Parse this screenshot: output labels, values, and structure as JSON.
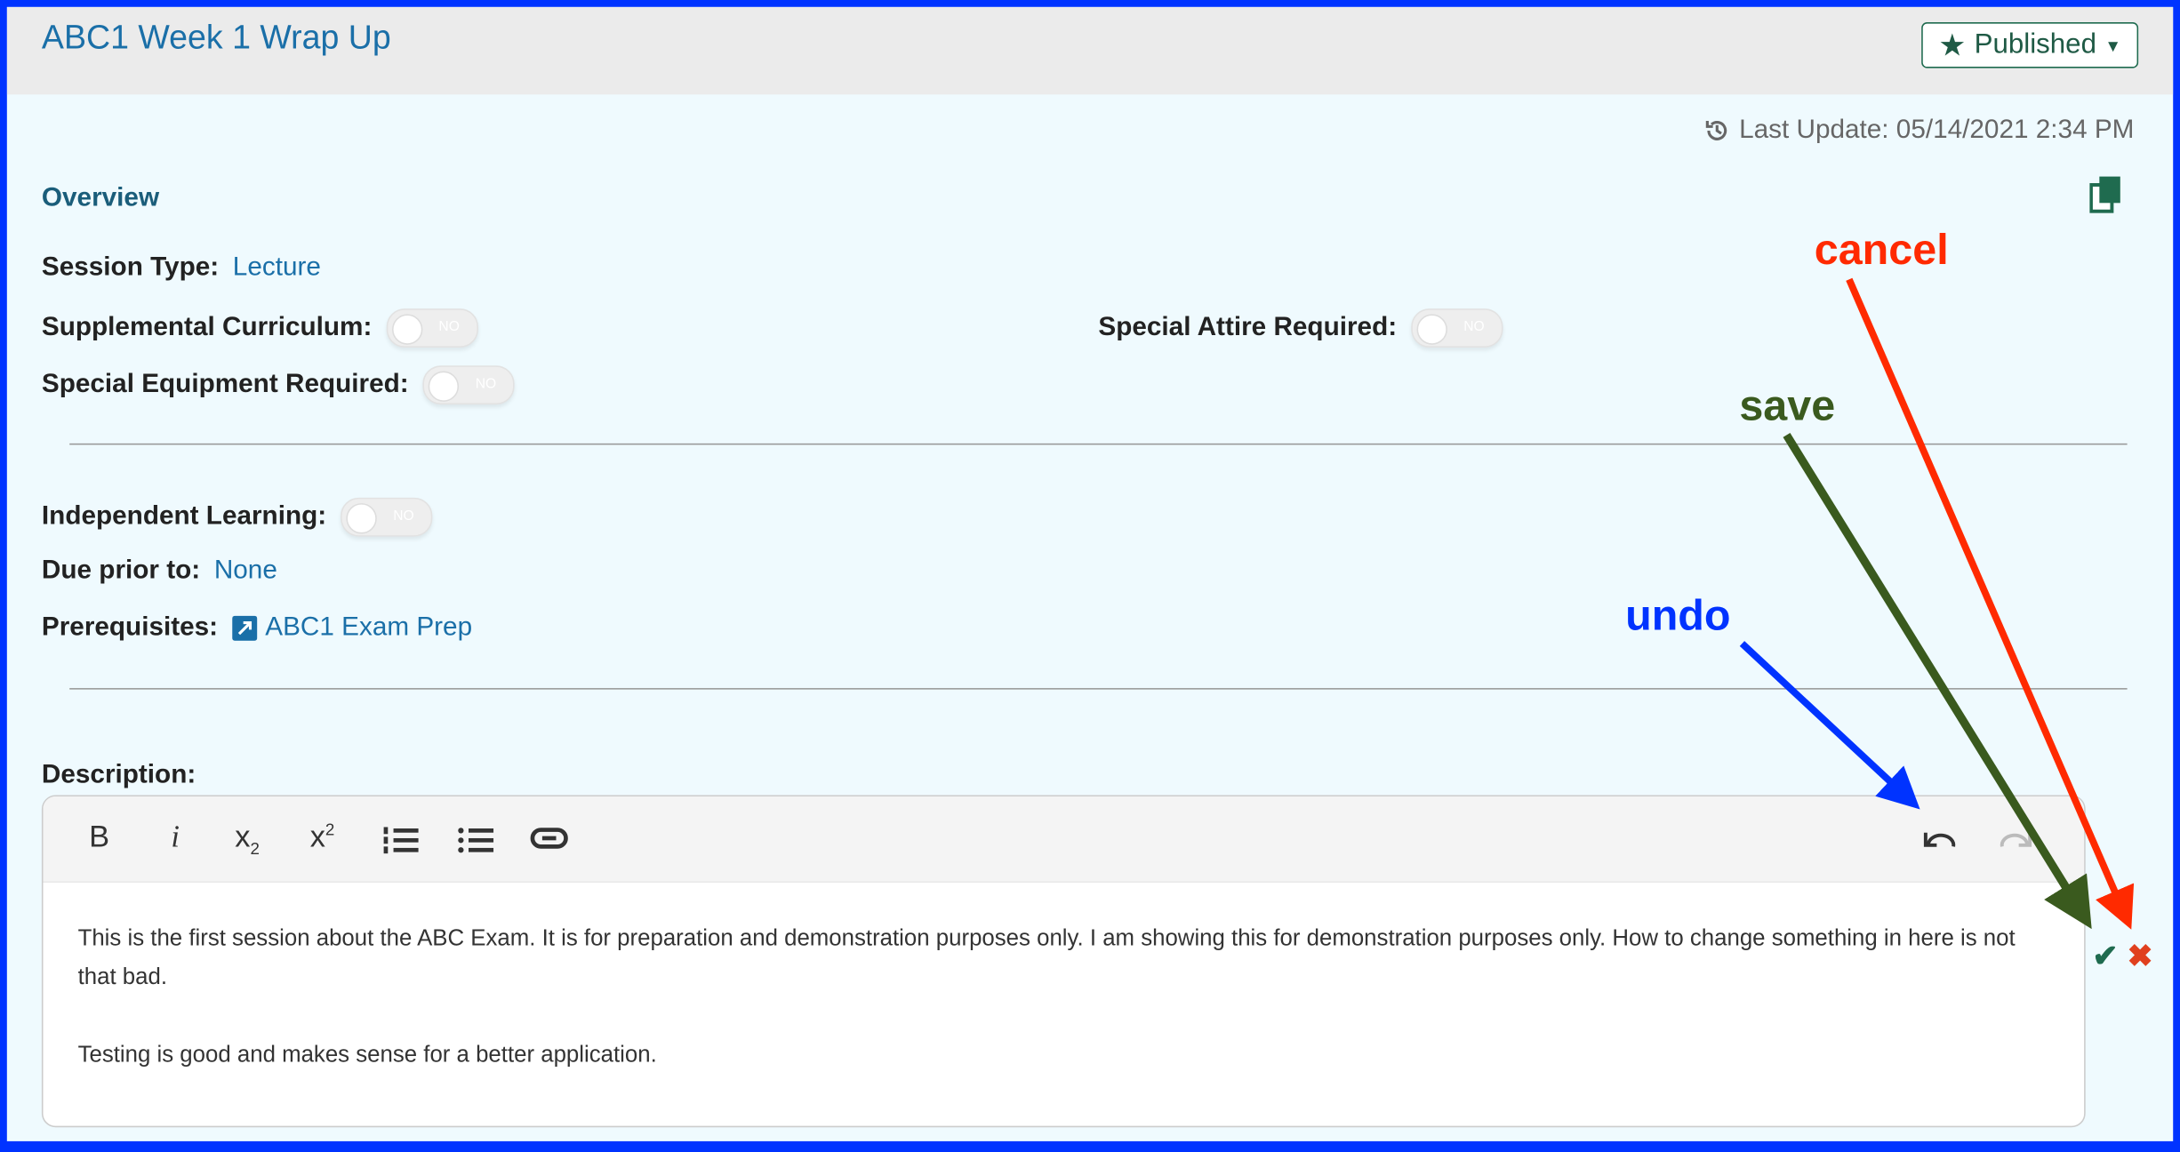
{
  "header": {
    "title": "ABC1 Week 1 Wrap Up",
    "status_button": "Published"
  },
  "last_update": "Last Update: 05/14/2021 2:34 PM",
  "overview": {
    "heading": "Overview",
    "session_type_label": "Session Type:",
    "session_type_value": "Lecture",
    "supplemental_label": "Supplemental Curriculum:",
    "supplemental_value": "NO",
    "attire_label": "Special Attire Required:",
    "attire_value": "NO",
    "equipment_label": "Special Equipment Required:",
    "equipment_value": "NO",
    "independent_label": "Independent Learning:",
    "independent_value": "NO",
    "due_label": "Due prior to:",
    "due_value": "None",
    "prereq_label": "Prerequisites:",
    "prereq_value": "ABC1 Exam Prep"
  },
  "description": {
    "label": "Description:",
    "toolbar": {
      "bold": "B",
      "italic": "i",
      "subscript": "x",
      "sub_mark": "2",
      "superscript": "x",
      "sup_mark": "2"
    },
    "paragraphs": [
      "This is the first session about the ABC Exam. It is for preparation and demonstration purposes only. I am showing this for demonstration purposes only. How to change something in here is not that bad.",
      "Testing is good and makes sense for a better application."
    ]
  },
  "annotations": {
    "cancel": "cancel",
    "save": "save",
    "undo": "undo"
  },
  "colors": {
    "frame": "#0033ff",
    "cancel": "#ff2a00",
    "save": "#3a5a1e",
    "undo": "#0033ff",
    "accent": "#1a6fa8"
  }
}
